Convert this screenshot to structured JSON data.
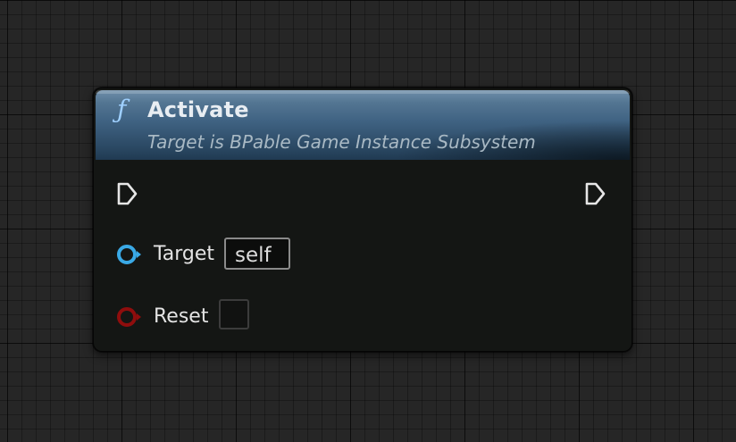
{
  "node": {
    "icon": "function-icon",
    "icon_glyph": "ƒ",
    "title": "Activate",
    "subtitle": "Target is BPable Game Instance Subsystem"
  },
  "pins": {
    "exec_in_icon": "exec-arrow-icon",
    "exec_out_icon": "exec-arrow-icon",
    "target": {
      "label": "Target",
      "value": "self",
      "color": "#3aa9e6"
    },
    "reset": {
      "label": "Reset",
      "checked": false,
      "color": "#8f0d0d"
    }
  },
  "colors": {
    "canvas": "#262626",
    "header_blue": "#3f6282",
    "node_body": "#141614"
  }
}
